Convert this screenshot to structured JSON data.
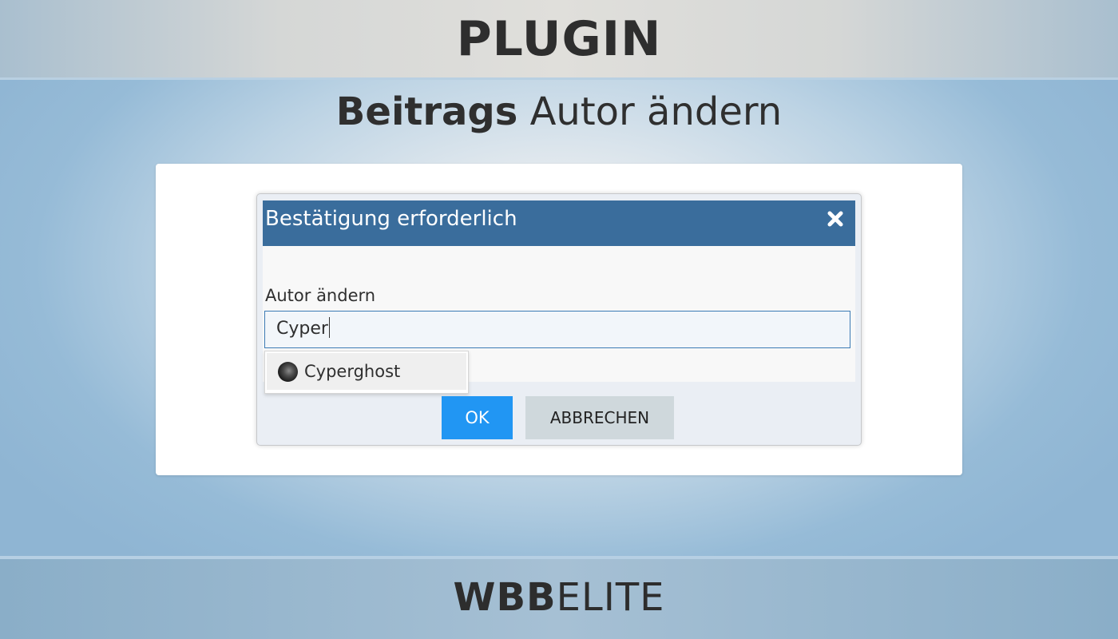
{
  "banner": {
    "title": "PLUGIN",
    "subtitle_bold": "Beitrags",
    "subtitle_rest": "Autor ändern"
  },
  "dialog": {
    "title": "Bestätigung erforderlich",
    "close_icon": "close-icon",
    "field_label": "Autor ändern",
    "input_value": "Cyper",
    "suggestions": [
      {
        "label": "Cyperghost",
        "avatar": "user-avatar"
      }
    ],
    "ok_label": "OK",
    "cancel_label": "ABBRECHEN",
    "colors": {
      "header": "#3a6d9c",
      "ok_button": "#2196f3",
      "cancel_button": "#cfd8dc"
    }
  },
  "footer": {
    "brand_bold": "WBB",
    "brand_light": "ELITE"
  }
}
